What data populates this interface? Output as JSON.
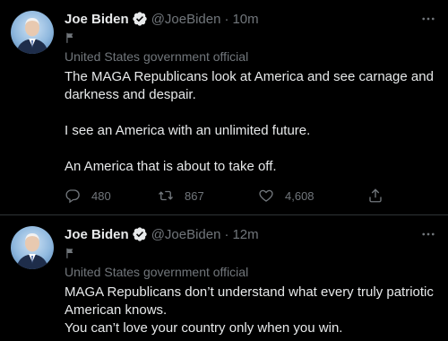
{
  "tweets": [
    {
      "name": "Joe Biden",
      "handle": "@JoeBiden",
      "separator": "·",
      "time": "10m",
      "label": "United States government official",
      "paragraphs": [
        "The MAGA Republicans look at America and see carnage and darkness and despair.",
        "I see an America with an unlimited future.",
        "An America that is about to take off."
      ],
      "replies": "480",
      "retweets": "867",
      "likes": "4,608"
    },
    {
      "name": "Joe Biden",
      "handle": "@JoeBiden",
      "separator": "·",
      "time": "12m",
      "label": "United States government official",
      "paragraphs": [
        "MAGA Republicans don’t understand what every truly patriotic American knows.",
        "You can’t love your country only when you win."
      ]
    }
  ],
  "colors": {
    "background": "#000000",
    "text": "#e7e9ea",
    "muted": "#71767b",
    "verified": "#1d9bf0",
    "divider": "#2f3336"
  },
  "icons": [
    "verified-badge-icon",
    "more-icon",
    "flag-icon",
    "reply-icon",
    "retweet-icon",
    "like-icon",
    "share-icon"
  ]
}
